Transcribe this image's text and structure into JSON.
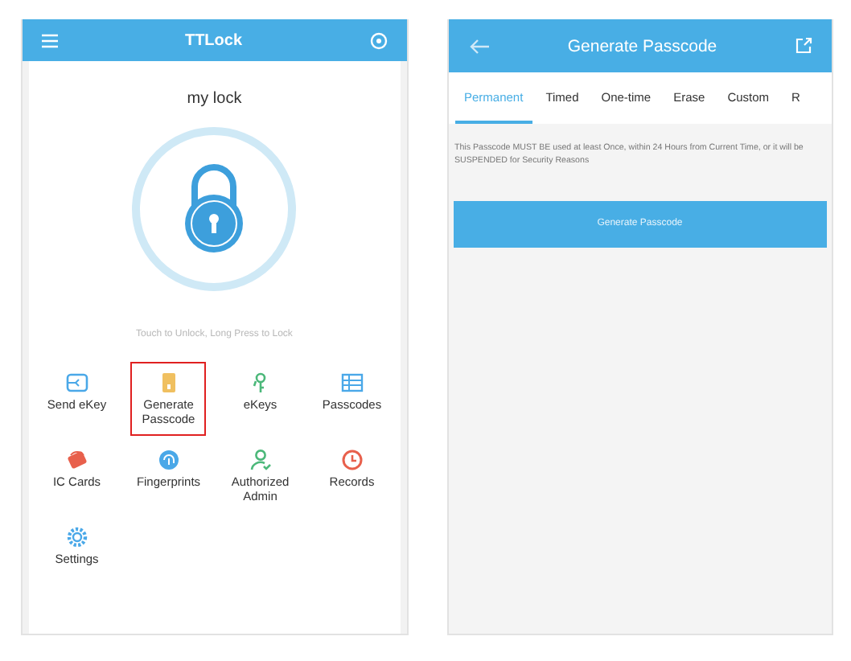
{
  "lock_screen": {
    "title": "TTLock",
    "lock_name": "my lock",
    "hint": "Touch to Unlock, Long Press to Lock",
    "features": [
      {
        "label": "Send eKey",
        "kind": "send",
        "color": "#4aa8e8",
        "selected": false
      },
      {
        "label": "Generate Passcode",
        "kind": "passcode",
        "color": "#f0c060",
        "selected": true
      },
      {
        "label": "eKeys",
        "kind": "key",
        "color": "#4cb87a",
        "selected": false
      },
      {
        "label": "Passcodes",
        "kind": "list",
        "color": "#4aa8e8",
        "selected": false
      },
      {
        "label": "IC Cards",
        "kind": "card",
        "color": "#e8604c",
        "selected": false
      },
      {
        "label": "Fingerprints",
        "kind": "finger",
        "color": "#4aa8e8",
        "selected": false
      },
      {
        "label": "Authorized Admin",
        "kind": "admin",
        "color": "#4cb87a",
        "selected": false
      },
      {
        "label": "Records",
        "kind": "clock",
        "color": "#e8604c",
        "selected": false
      },
      {
        "label": "Settings",
        "kind": "gear",
        "color": "#4aa8e8",
        "selected": false
      }
    ]
  },
  "passcode_screen": {
    "title": "Generate Passcode",
    "tabs": [
      {
        "label": "Permanent",
        "selected": true
      },
      {
        "label": "Timed",
        "selected": false
      },
      {
        "label": "One-time",
        "selected": false
      },
      {
        "label": "Erase",
        "selected": false
      },
      {
        "label": "Custom",
        "selected": false
      },
      {
        "label": "R",
        "selected": false
      }
    ],
    "notice": "This Passcode MUST BE used at least Once, within 24 Hours from Current Time, or it will be SUSPENDED for Security Reasons",
    "button": "Generate Passcode"
  }
}
